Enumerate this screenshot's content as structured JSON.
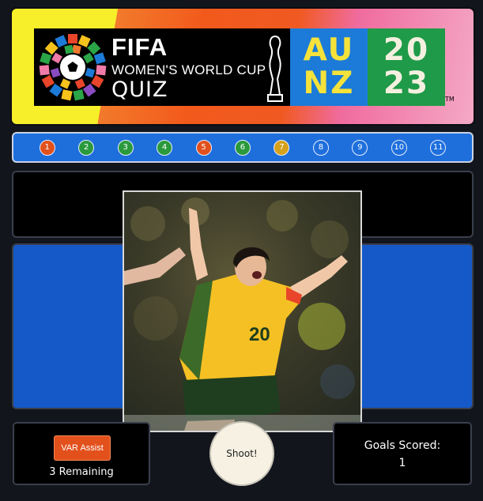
{
  "banner": {
    "fifa": "FIFA",
    "subtitle": "WOMEN'S WORLD CUP",
    "quiz": "QUIZ",
    "host_line1": "AU",
    "host_line2": "NZ",
    "year_line1": "20",
    "year_line2": "23",
    "trademark": "TM"
  },
  "questions": [
    {
      "label": "1",
      "color": "#e2501c"
    },
    {
      "label": "2",
      "color": "#2a9a3c"
    },
    {
      "label": "3",
      "color": "#2a9a3c"
    },
    {
      "label": "4",
      "color": "#2a9a3c"
    },
    {
      "label": "5",
      "color": "#e2501c"
    },
    {
      "label": "6",
      "color": "#2a9a3c"
    },
    {
      "label": "7",
      "color": "#d6a21c"
    },
    {
      "label": "8",
      "color": "#1e6fdc"
    },
    {
      "label": "9",
      "color": "#1e6fdc"
    },
    {
      "label": "10",
      "color": "#1e6fdc"
    },
    {
      "label": "11",
      "color": "#1e6fdc"
    }
  ],
  "photo": {
    "jersey_number": "20",
    "colors": {
      "jersey": "#f5c023",
      "shorts": "#1f3d1f",
      "trim": "#1b5a2a"
    }
  },
  "var": {
    "button_label": "VAR Assist",
    "remaining": "3 Remaining"
  },
  "shoot": {
    "label": "Shoot!"
  },
  "goals": {
    "label": "Goals Scored:",
    "value": "1"
  },
  "colors": {
    "background": "#12151c",
    "strip": "#1e6fdc",
    "panel_blue": "#1559c9",
    "var_button": "#e2501c"
  }
}
